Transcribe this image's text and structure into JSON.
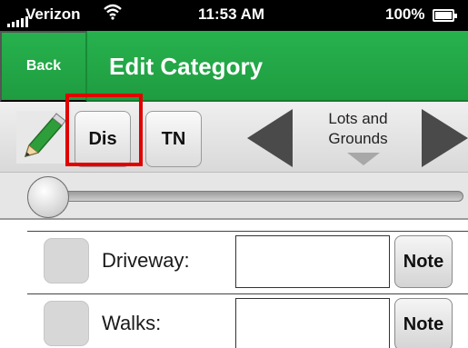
{
  "status_bar": {
    "carrier": "Verizon",
    "time": "11:53 AM",
    "battery": "100%"
  },
  "nav": {
    "back_label": "Back",
    "title": "Edit Category"
  },
  "toolbar": {
    "buttons": [
      {
        "label": "Dis",
        "highlighted": true
      },
      {
        "label": "TN",
        "highlighted": false
      }
    ],
    "category_label": "Lots and Grounds"
  },
  "slider": {
    "value": 0.0
  },
  "items": [
    {
      "label": "Driveway:",
      "value": "",
      "note_label": "Note"
    },
    {
      "label": "Walks:",
      "value": "",
      "note_label": "Note"
    }
  ],
  "colors": {
    "nav_green": "#27b24e",
    "highlight_red": "#e00000",
    "pencil_green": "#2e9e3a"
  }
}
